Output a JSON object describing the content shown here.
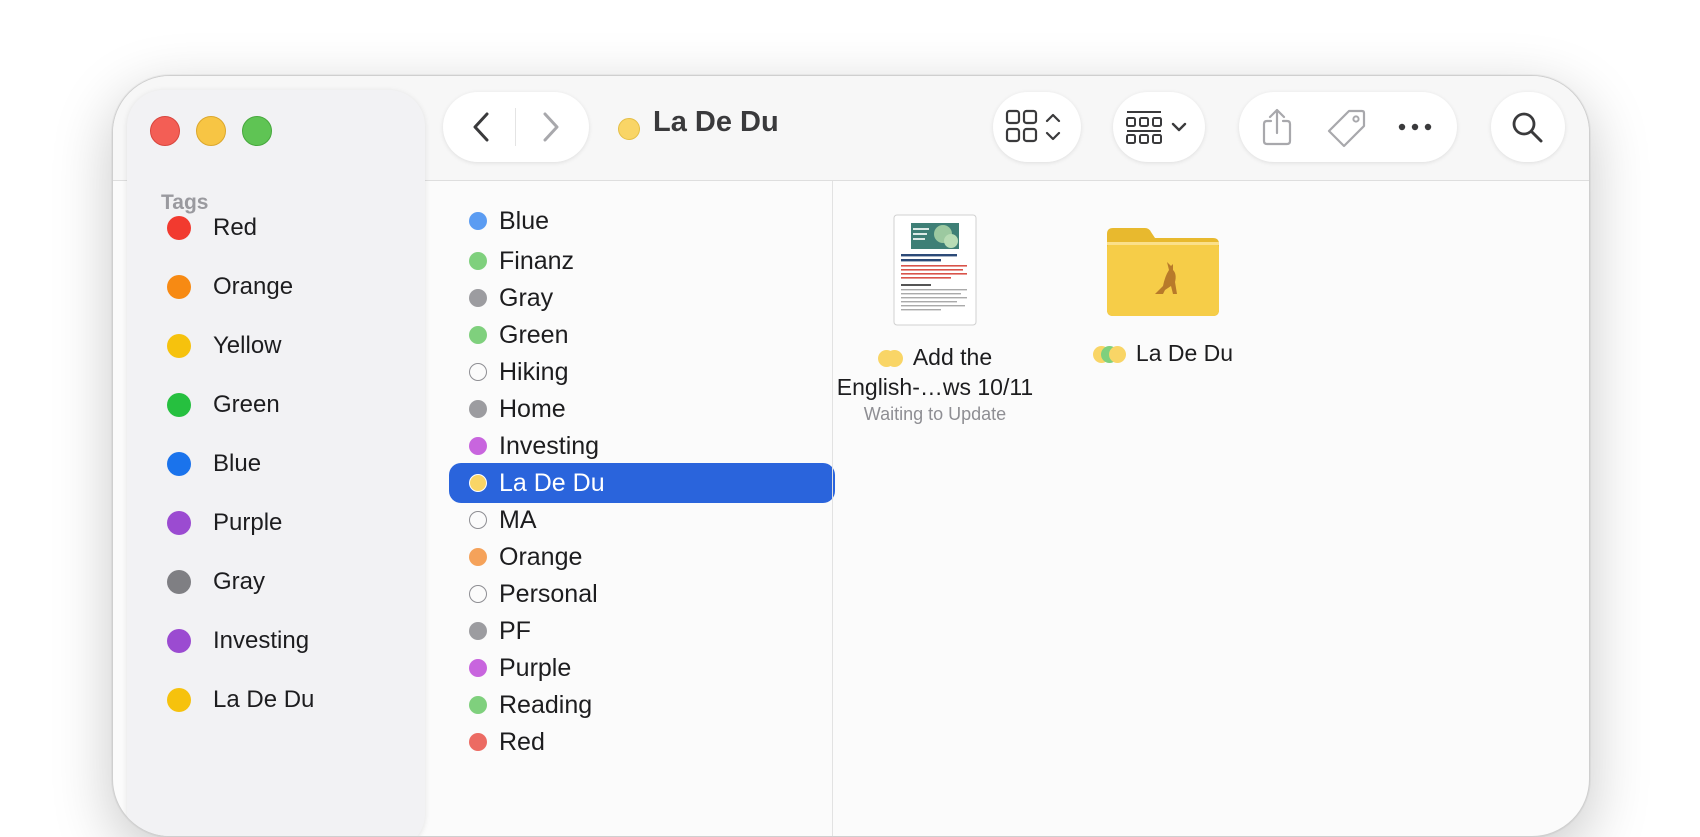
{
  "window": {
    "title": "La De Du",
    "title_tag_color": "#f9d566"
  },
  "sidebar": {
    "heading": "Tags",
    "items": [
      {
        "label": "Red",
        "color": "#f23a2f"
      },
      {
        "label": "Orange",
        "color": "#f78a13"
      },
      {
        "label": "Yellow",
        "color": "#f6c20d"
      },
      {
        "label": "Green",
        "color": "#26c03f"
      },
      {
        "label": "Blue",
        "color": "#1a73ec"
      },
      {
        "label": "Purple",
        "color": "#9b4bd1"
      },
      {
        "label": "Gray",
        "color": "#7f7f83"
      },
      {
        "label": "Investing",
        "color": "#9b4bd1"
      },
      {
        "label": "La De Du",
        "color": "#f6c20d"
      }
    ]
  },
  "toolbar": {
    "back_icon": "chevron-left-icon",
    "forward_icon": "chevron-right-icon",
    "view_icon": "grid-view-icon",
    "group_icon": "group-by-icon",
    "share_icon": "share-icon",
    "tag_icon": "tag-icon",
    "more_icon": "more-icon",
    "search_icon": "search-icon"
  },
  "tag_list": {
    "selected": "La De Du",
    "items": [
      {
        "label": "Blue",
        "color": "#5b9cf2"
      },
      {
        "label": "Finanz",
        "color": "#7fd07d"
      },
      {
        "label": "Gray",
        "color": "#9c9ca0"
      },
      {
        "label": "Green",
        "color": "#7fd07d"
      },
      {
        "label": "Hiking",
        "color": ""
      },
      {
        "label": "Home",
        "color": "#9c9ca0"
      },
      {
        "label": "Investing",
        "color": "#c865de"
      },
      {
        "label": "La De Du",
        "color": "#f9d566"
      },
      {
        "label": "MA",
        "color": ""
      },
      {
        "label": "Orange",
        "color": "#f5a25a"
      },
      {
        "label": "Personal",
        "color": ""
      },
      {
        "label": "PF",
        "color": "#9c9ca0"
      },
      {
        "label": "Purple",
        "color": "#c865de"
      },
      {
        "label": "Reading",
        "color": "#7fd07d"
      },
      {
        "label": "Red",
        "color": "#ec6b63"
      }
    ]
  },
  "files": [
    {
      "name_line1": "Add the",
      "name_line2": "English-…ws 10/11",
      "status": "Waiting to Update",
      "tags": [
        "#f9d566",
        "#f9d566"
      ]
    },
    {
      "name_line1": "La De Du",
      "tags": [
        "#f9d566",
        "#7fd07d",
        "#f9d566"
      ]
    }
  ],
  "document_thumb": {
    "heading": "Add the English International Keyboard in Windows 10/11"
  }
}
